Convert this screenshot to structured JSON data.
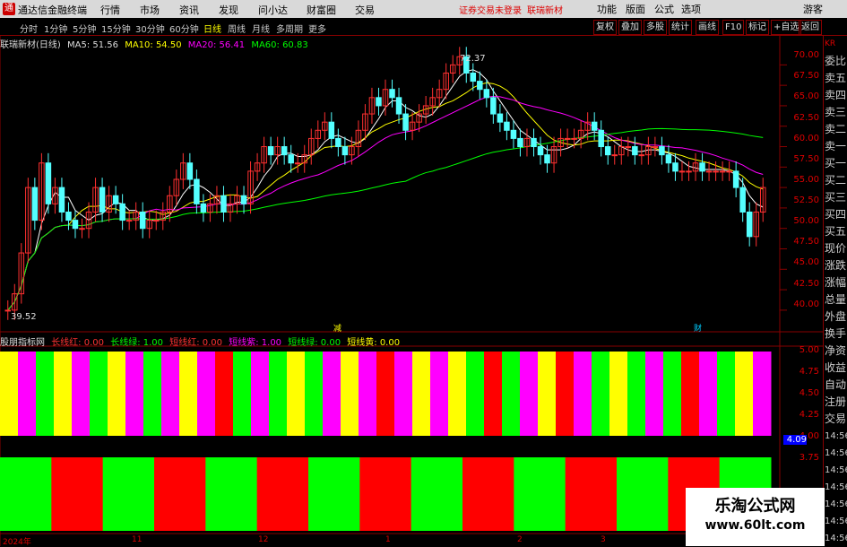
{
  "app": {
    "name": "通达信金融终端",
    "logo": "通"
  },
  "menu": [
    "行情",
    "市场",
    "资讯",
    "发现",
    "问小达",
    "财富圈",
    "交易"
  ],
  "status": {
    "login": "证券交易未登录",
    "stock": "联瑞新材"
  },
  "window_buttons": [
    "功能",
    "版面",
    "公式",
    "选项",
    "游客"
  ],
  "toolbar": {
    "periods": [
      "分时",
      "1分钟",
      "5分钟",
      "15分钟",
      "30分钟",
      "60分钟",
      "日线",
      "周线",
      "月线",
      "多周期",
      "更多"
    ],
    "right": [
      "复权",
      "叠加",
      "多股",
      "统计",
      "画线",
      "F10",
      "标记",
      "+自选",
      "返回"
    ]
  },
  "legend": {
    "title": "联瑞新材(日线)",
    "ma5": "MA5: 51.56",
    "ma10": "MA10: 54.50",
    "ma20": "MA20: 56.41",
    "ma60": "MA60: 60.83"
  },
  "price_axis": [
    "70.00",
    "67.50",
    "65.00",
    "62.50",
    "60.00",
    "57.50",
    "55.00",
    "52.50",
    "50.00",
    "47.50",
    "45.00",
    "42.50",
    "40.00"
  ],
  "annotations": {
    "high": "72.37",
    "low": "39.52",
    "mark1": "减",
    "mark2": "财"
  },
  "indicator": {
    "name": "股朋指标网",
    "items": [
      "长线红: 0.00",
      "长线绿: 1.00",
      "短线红: 0.00",
      "短线紫: 1.00",
      "短线绿: 0.00",
      "短线黄: 0.00"
    ],
    "axis": [
      "5.00",
      "4.75",
      "4.50",
      "4.25",
      "4.00",
      "3.75"
    ],
    "current": "4.09"
  },
  "right_panel": [
    "KR",
    "委比",
    "卖五",
    "卖四",
    "卖三",
    "卖二",
    "卖一",
    "买一",
    "买二",
    "买三",
    "买四",
    "买五",
    "现价",
    "涨跌",
    "涨幅",
    "总量",
    "外盘",
    "换手",
    "净资",
    "收益",
    "自动",
    "注册",
    "交易",
    "14:56",
    "14:56",
    "14:56",
    "14:56",
    "14:56",
    "14:56",
    "14:56"
  ],
  "dates": [
    "2024年",
    "11",
    "12",
    "1",
    "2",
    "3"
  ],
  "watermark": {
    "line1": "乐淘公式网",
    "line2": "www.60lt.com"
  },
  "chart_data": {
    "type": "candlestick",
    "title": "联瑞新材(日线)",
    "ylim": [
      39,
      73
    ],
    "closes": [
      40,
      42,
      47,
      55,
      51,
      58,
      53,
      55,
      52,
      51,
      50,
      50,
      52,
      55,
      52,
      54,
      53,
      51,
      51,
      52,
      50,
      51,
      51,
      52,
      54,
      56,
      58,
      56,
      53,
      52,
      53,
      54,
      52,
      53,
      54,
      53,
      57,
      58,
      60,
      59,
      60,
      59,
      58,
      58,
      59,
      61,
      62,
      63,
      61,
      60,
      59,
      60,
      62,
      64,
      66,
      65,
      67,
      66,
      64,
      62,
      63,
      64,
      65,
      66,
      67,
      69,
      70,
      71,
      69,
      68,
      67,
      66,
      64,
      63,
      62,
      61,
      60,
      61,
      60,
      59,
      58,
      60,
      61,
      61,
      61,
      62,
      63,
      62,
      60,
      59,
      59,
      60,
      60,
      59,
      59,
      60,
      60,
      59,
      58,
      57,
      57,
      57,
      58,
      57,
      57,
      57,
      57,
      57,
      55,
      52,
      49,
      52,
      55
    ]
  },
  "bands": {
    "top": [
      "#ffff00",
      "#ff00ff",
      "#00ff00",
      "#ffff00",
      "#ff00ff",
      "#00ff00",
      "#ffff00",
      "#ff00ff",
      "#00ff00",
      "#ff00ff",
      "#ffff00",
      "#ff00ff",
      "#ff0000",
      "#00ff00",
      "#ff00ff",
      "#00ff00",
      "#ffff00",
      "#00ff00",
      "#ff00ff",
      "#ffff00",
      "#ff00ff",
      "#ff0000",
      "#ff00ff",
      "#ffff00",
      "#ff00ff",
      "#ffff00",
      "#00ff00",
      "#ff0000",
      "#00ff00",
      "#ff00ff",
      "#ffff00",
      "#ff0000",
      "#ff00ff",
      "#00ff00",
      "#ffff00",
      "#00ff00",
      "#ff00ff",
      "#00ff00",
      "#ff0000",
      "#ff00ff",
      "#00ff00",
      "#ffff00",
      "#ff00ff"
    ],
    "bottom": [
      "#00ff00",
      "#ff0000",
      "#00ff00",
      "#ff0000",
      "#00ff00",
      "#ff0000",
      "#00ff00",
      "#ff0000",
      "#00ff00",
      "#ff0000",
      "#00ff00",
      "#ff0000",
      "#00ff00",
      "#ff0000",
      "#00ff00"
    ]
  }
}
